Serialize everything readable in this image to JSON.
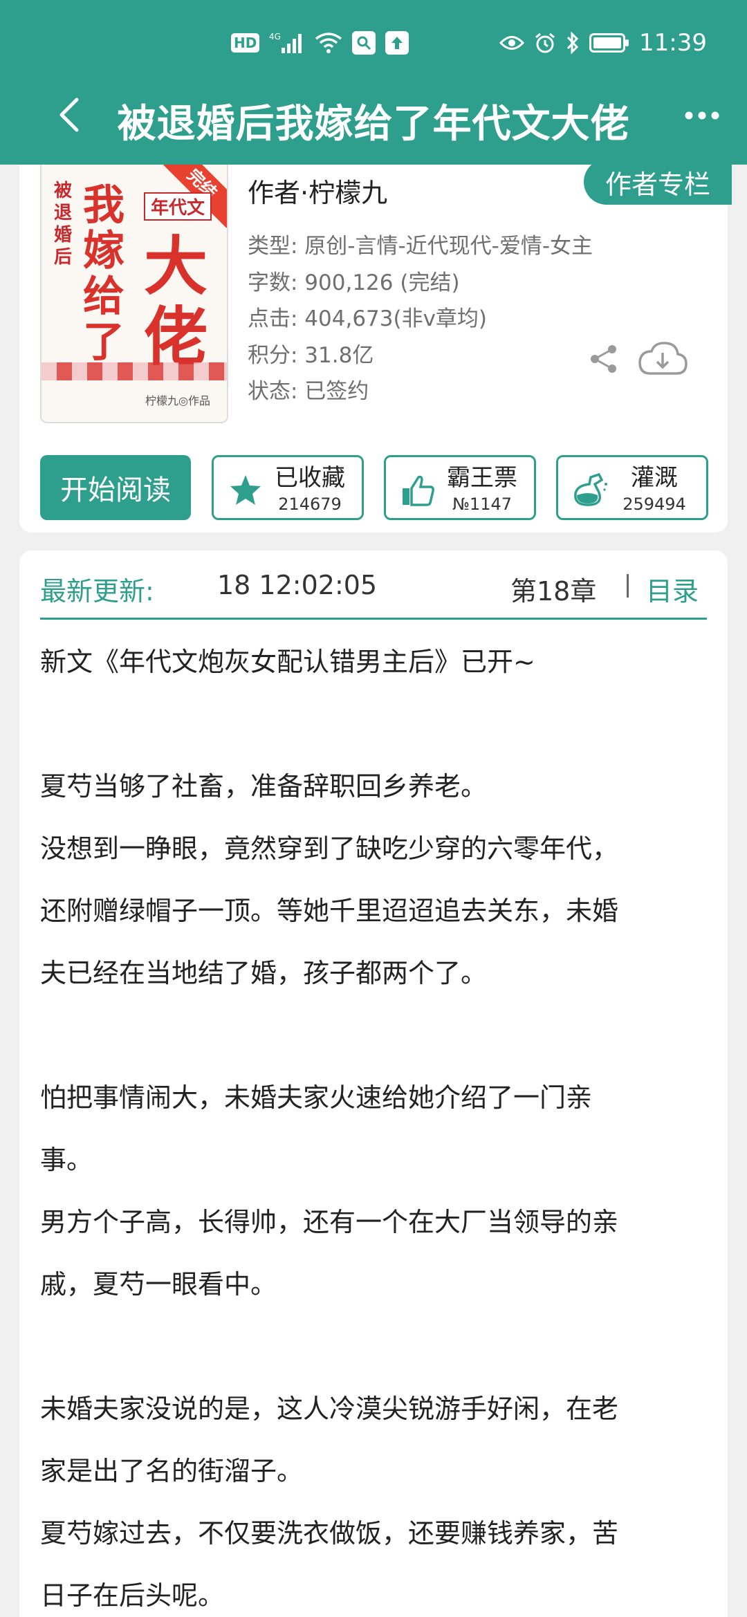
{
  "status_bar": {
    "hd": "HD",
    "network": "4G",
    "time": "11:39",
    "icons": [
      "signal-icon",
      "wifi-icon",
      "search-app-icon",
      "upload-icon",
      "eye-icon",
      "alarm-icon",
      "bluetooth-icon",
      "battery-icon"
    ]
  },
  "header": {
    "title": "被退婚后我嫁给了年代文大佬",
    "bg_color": "#2f9f8d"
  },
  "book": {
    "cover": {
      "ribbon": "完结",
      "small_title": "被退婚后",
      "big_title": "我嫁给了",
      "huge_title": "大佬",
      "tag": "年代文",
      "author_mark": "柠檬九◎作品"
    },
    "author": "作者·柠檬九",
    "author_column_label": "作者专栏",
    "meta": {
      "type": "类型: 原创-言情-近代现代-爱情-女主",
      "words": "字数: 900,126 (完结)",
      "clicks": "点击: 404,673(非v章均)",
      "points": "积分: 31.8亿",
      "status": "状态: 已签约"
    }
  },
  "actions": {
    "read_label": "开始阅读",
    "favorite": {
      "label": "已收藏",
      "count": "214679"
    },
    "vote": {
      "label": "霸王票",
      "count": "№1147"
    },
    "nutrient": {
      "label": "灌溉",
      "count": "259494"
    }
  },
  "update": {
    "label": "最新更新:",
    "time": "18 12:02:05",
    "chapter": "第18章",
    "toc_label": "目录"
  },
  "description": [
    "新文《年代文炮灰女配认错男主后》已开~",
    "",
    "夏芍当够了社畜，准备辞职回乡养老。",
    "没想到一睁眼，竟然穿到了缺吃少穿的六零年代，",
    "还附赠绿帽子一顶。等她千里迢迢追去关东，未婚",
    "夫已经在当地结了婚，孩子都两个了。",
    "",
    "怕把事情闹大，未婚夫家火速给她介绍了一门亲",
    "事。",
    "男方个子高，长得帅，还有一个在大厂当领导的亲",
    "戚，夏芍一眼看中。",
    "",
    "未婚夫家没说的是，这人冷漠尖锐游手好闲，在老",
    "家是出了名的街溜子。",
    "夏芍嫁过去，不仅要洗衣做饭，还要赚钱养家，苦",
    "日子在后头呢。"
  ]
}
